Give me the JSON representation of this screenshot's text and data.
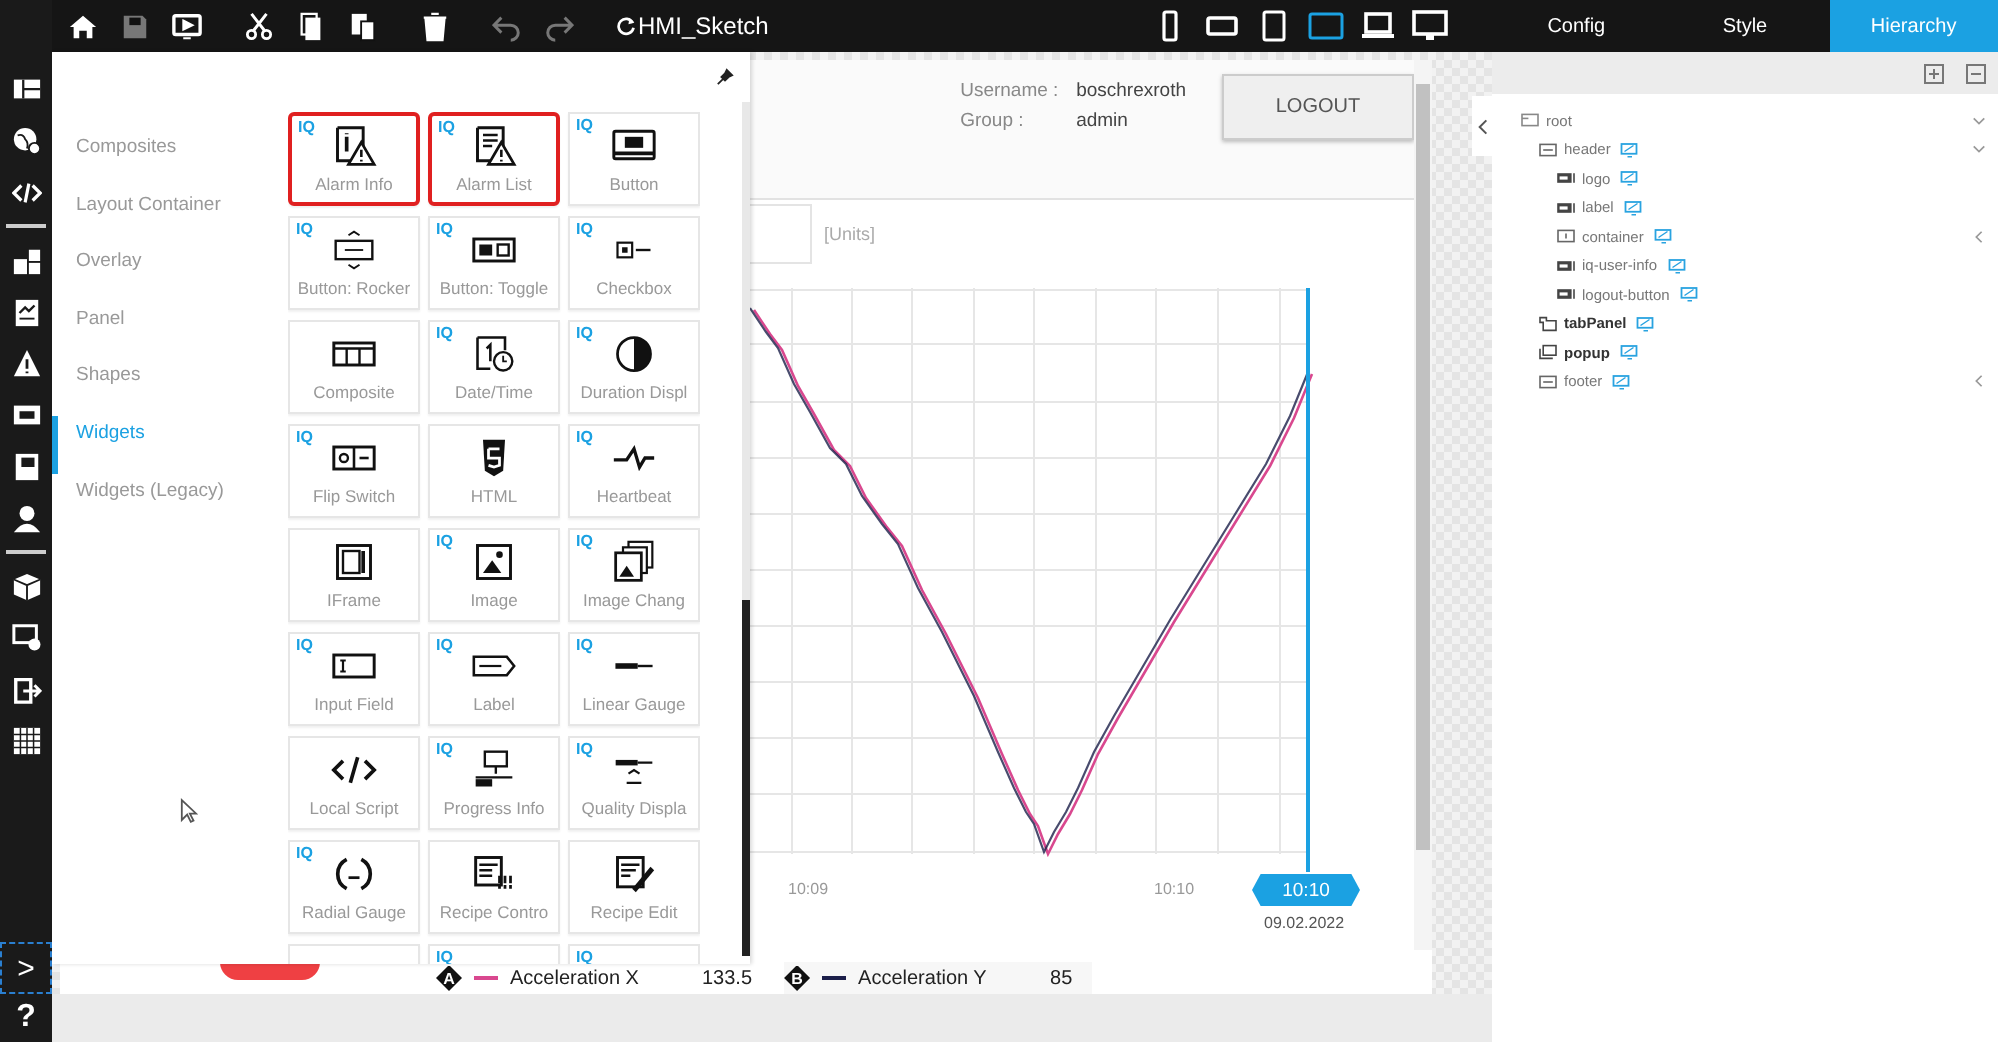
{
  "toolbar": {
    "buttons": [
      {
        "kind": "home",
        "disabled": false
      },
      {
        "kind": "save",
        "disabled": true
      },
      {
        "kind": "present",
        "disabled": false
      },
      {
        "kind": "cut",
        "disabled": false
      },
      {
        "kind": "copy",
        "disabled": false
      },
      {
        "kind": "paste",
        "disabled": false
      },
      {
        "kind": "delete",
        "disabled": false
      },
      {
        "kind": "undo",
        "disabled": true
      },
      {
        "kind": "redo",
        "disabled": true
      }
    ],
    "title": "HMI_Sketch",
    "devices": [
      {
        "kind": "phone",
        "selected": false
      },
      {
        "kind": "phone-landscape",
        "selected": false
      },
      {
        "kind": "tablet",
        "selected": false
      },
      {
        "kind": "tablet-landscape",
        "selected": true
      },
      {
        "kind": "laptop",
        "selected": false
      },
      {
        "kind": "desktop",
        "selected": false
      }
    ]
  },
  "rail": {
    "items": [
      {
        "kind": "layout"
      },
      {
        "kind": "globe"
      },
      {
        "kind": "code"
      },
      {
        "kind": "divider"
      },
      {
        "kind": "widgets"
      },
      {
        "kind": "trend"
      },
      {
        "kind": "alarm"
      },
      {
        "kind": "screen"
      },
      {
        "kind": "book"
      },
      {
        "kind": "user"
      },
      {
        "kind": "divider"
      },
      {
        "kind": "cube"
      },
      {
        "kind": "display-gear"
      },
      {
        "kind": "export"
      },
      {
        "kind": "grid"
      }
    ],
    "expand": ">",
    "help": "?"
  },
  "palette": {
    "categories": [
      {
        "label": "Composites",
        "selected": false
      },
      {
        "label": "Layout Container",
        "selected": false
      },
      {
        "label": "Overlay",
        "selected": false
      },
      {
        "label": "Panel",
        "selected": false
      },
      {
        "label": "Shapes",
        "selected": false
      },
      {
        "label": "Widgets",
        "selected": true
      },
      {
        "label": "Widgets (Legacy)",
        "selected": false
      }
    ],
    "widgets": [
      {
        "label": "Alarm Info",
        "kind": "alarm-info",
        "badge": "IQ",
        "highlighted": true
      },
      {
        "label": "Alarm List",
        "kind": "alarm-list",
        "badge": "IQ",
        "highlighted": true
      },
      {
        "label": "Button",
        "kind": "button",
        "badge": "IQ",
        "highlighted": false
      },
      {
        "label": "Button: Rocker",
        "kind": "rocker",
        "badge": "IQ",
        "highlighted": false
      },
      {
        "label": "Button: Toggle",
        "kind": "toggle",
        "badge": "IQ",
        "highlighted": false
      },
      {
        "label": "Checkbox",
        "kind": "checkbox",
        "badge": "IQ",
        "highlighted": false
      },
      {
        "label": "Composite",
        "kind": "composite",
        "highlighted": false
      },
      {
        "label": "Date/Time",
        "kind": "datetime",
        "badge": "IQ",
        "highlighted": false
      },
      {
        "label": "Duration Displ",
        "kind": "duration",
        "badge": "IQ",
        "highlighted": false
      },
      {
        "label": "Flip Switch",
        "kind": "flip",
        "badge": "IQ",
        "highlighted": false
      },
      {
        "label": "HTML",
        "kind": "html",
        "highlighted": false
      },
      {
        "label": "Heartbeat",
        "kind": "heartbeat",
        "badge": "IQ",
        "highlighted": false
      },
      {
        "label": "IFrame",
        "kind": "iframe",
        "highlighted": false
      },
      {
        "label": "Image",
        "kind": "image",
        "badge": "IQ",
        "highlighted": false
      },
      {
        "label": "Image Chang",
        "kind": "image-stack",
        "badge": "IQ",
        "highlighted": false
      },
      {
        "label": "Input Field",
        "kind": "input",
        "badge": "IQ",
        "highlighted": false
      },
      {
        "label": "Label",
        "kind": "label",
        "badge": "IQ",
        "highlighted": false
      },
      {
        "label": "Linear Gauge",
        "kind": "linear",
        "badge": "IQ",
        "highlighted": false
      },
      {
        "label": "Local Script",
        "kind": "script",
        "highlighted": false
      },
      {
        "label": "Progress Info",
        "kind": "progress",
        "badge": "IQ",
        "highlighted": false
      },
      {
        "label": "Quality Displa",
        "kind": "quality",
        "badge": "IQ",
        "highlighted": false
      },
      {
        "label": "Radial Gauge",
        "kind": "radial",
        "badge": "IQ",
        "highlighted": false
      },
      {
        "label": "Recipe Contro",
        "kind": "recipe-control",
        "highlighted": false
      },
      {
        "label": "Recipe Edit",
        "kind": "recipe-edit",
        "highlighted": false
      },
      {
        "kind": "blank",
        "highlighted": false
      },
      {
        "kind": "blank",
        "badge": "IQ",
        "highlighted": false
      },
      {
        "kind": "blank",
        "badge": "IQ",
        "highlighted": false
      }
    ]
  },
  "page": {
    "user_info": {
      "username_label": "Username :",
      "username": "boschrexroth",
      "group_label": "Group :",
      "group": "admin"
    },
    "logout_button": "LOGOUT",
    "chart": {
      "units": "[Units]",
      "x_labels": [
        "10:09",
        "10:10"
      ],
      "cursor_time": "10:10",
      "cursor_date": "09.02.2022",
      "legend": [
        {
          "badge": "A",
          "name": "Acceleration X",
          "value": "133.5",
          "color": "#d9488f"
        },
        {
          "badge": "B",
          "name": "Acceleration Y",
          "value": "85",
          "color": "#1c1f4a"
        }
      ]
    }
  },
  "right_panel": {
    "tabs": [
      {
        "label": "Config",
        "selected": false
      },
      {
        "label": "Style",
        "selected": false
      },
      {
        "label": "Hierarchy",
        "selected": true
      }
    ],
    "tree": [
      {
        "label": "root",
        "kind": "page",
        "expanded": true,
        "children": [
          {
            "label": "header",
            "kind": "container",
            "expanded": true,
            "children": [
              {
                "label": "logo",
                "kind": "element"
              },
              {
                "label": "label",
                "kind": "element"
              },
              {
                "label": "container",
                "kind": "group",
                "expanded": false
              },
              {
                "label": "iq-user-info",
                "kind": "element"
              },
              {
                "label": "logout-button",
                "kind": "element"
              }
            ]
          },
          {
            "label": "tabPanel",
            "kind": "tabpanel"
          },
          {
            "label": "popup",
            "kind": "popup"
          },
          {
            "label": "footer",
            "kind": "container",
            "expanded": false
          }
        ]
      }
    ]
  }
}
